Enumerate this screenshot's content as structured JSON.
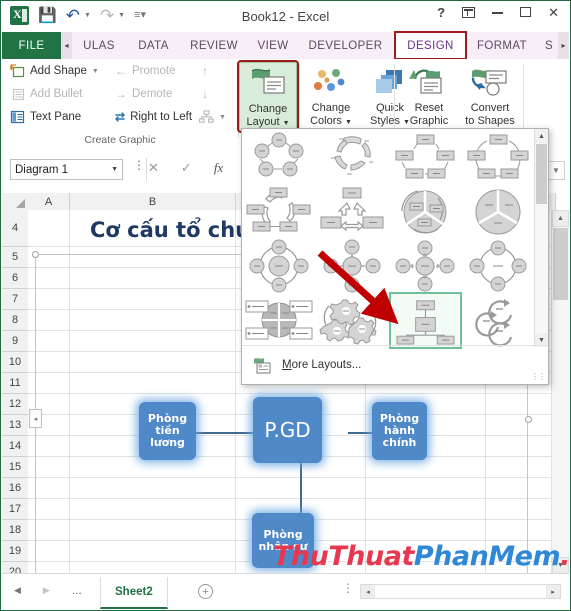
{
  "window": {
    "title": "Book12 - Excel",
    "quick_access": [
      "excel-logo",
      "save-icon",
      "undo-icon",
      "redo-icon",
      "customize-qat-icon"
    ],
    "buttons": [
      "?",
      "ribbon-display-options",
      "minimize",
      "restore",
      "close"
    ]
  },
  "tabs": {
    "file": "FILE",
    "items": [
      {
        "label": "ULAS",
        "active": false
      },
      {
        "label": "DATA",
        "active": false
      },
      {
        "label": "REVIEW",
        "active": false
      },
      {
        "label": "VIEW",
        "active": false
      },
      {
        "label": "DEVELOPER",
        "active": false
      },
      {
        "label": "DESIGN",
        "active": true,
        "highlighted": true
      },
      {
        "label": "FORMAT",
        "active": false
      },
      {
        "label": "S",
        "active": false
      }
    ],
    "scroll_left": "◂",
    "scroll_right": "▸"
  },
  "ribbon": {
    "create_graphic": {
      "group_label": "Create Graphic",
      "add_shape": "Add Shape",
      "add_bullet": "Add Bullet",
      "text_pane": "Text Pane",
      "promote": "Promote",
      "demote": "Demote",
      "right_to_left": "Right to Left"
    },
    "layouts": {
      "change_layout_l1": "Change",
      "change_layout_l2": "Layout"
    },
    "styles": {
      "change_colors_l1": "Change",
      "change_colors_l2": "Colors",
      "quick_styles_l1": "Quick",
      "quick_styles_l2": "Styles"
    },
    "reset": {
      "reset_graphic_l1": "Reset",
      "reset_graphic_l2": "Graphic",
      "convert_l1": "Convert",
      "convert_l2": "to Shapes"
    }
  },
  "formula_bar": {
    "name_box": "Diagram 1",
    "cancel": "✕",
    "enter": "✓",
    "fx": "fx",
    "value": ""
  },
  "gallery": {
    "more_layouts": "More Layouts...",
    "more_layouts_accel": "M",
    "selected_index": 14,
    "rows": 4,
    "cols": 4,
    "scroll_up": "▲",
    "scroll_down": "▼"
  },
  "grid": {
    "columns": [
      "A",
      "B"
    ],
    "rows": [
      "4",
      "5",
      "6",
      "7",
      "8",
      "9",
      "10",
      "11",
      "12",
      "13",
      "14",
      "15",
      "16",
      "17",
      "18",
      "19",
      "20"
    ],
    "title_cell": "Cơ cấu tổ chức"
  },
  "smartart": {
    "nodes": [
      {
        "id": "left",
        "text": "Phòng tiền lương"
      },
      {
        "id": "center",
        "text": "P.GD"
      },
      {
        "id": "right",
        "text": "Phòng hành chính"
      },
      {
        "id": "bottom",
        "text": "Phòng nhân sự"
      }
    ],
    "node_color": "#4f89c8",
    "glow_color": "#6ca8e1",
    "text_pane_toggle": "◂"
  },
  "status_bar": {
    "nav_first": "◀",
    "nav_last": "▶",
    "nav_dots": "...",
    "sheet_name": "Sheet2",
    "add_sheet": "⊕",
    "scroll_left": "◂",
    "scroll_right": "▸"
  },
  "watermark": {
    "part1": "ThuThuat",
    "part2": "PhanMem",
    "part3": ".vn",
    "color1": "#e8384f",
    "color2": "#2f87d8"
  }
}
